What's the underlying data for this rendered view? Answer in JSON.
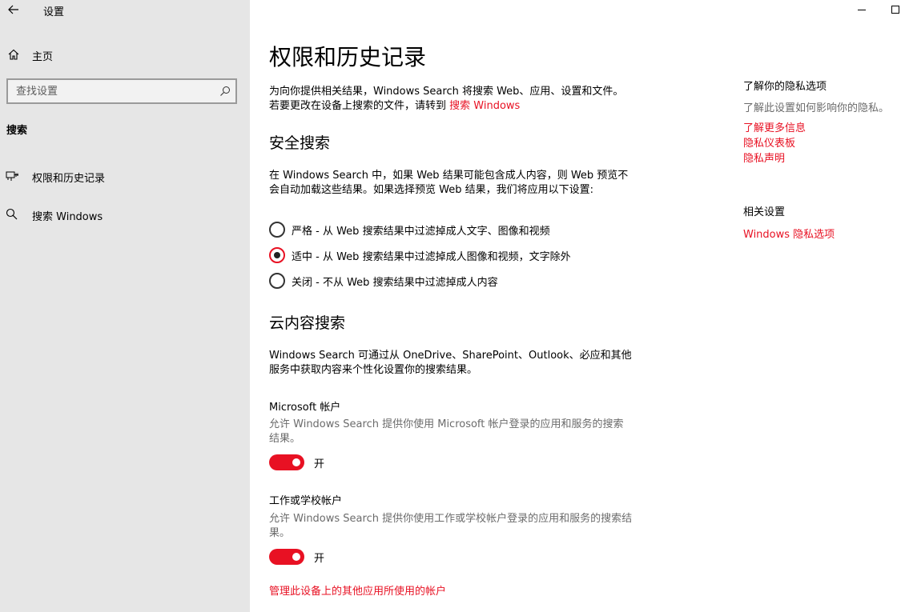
{
  "window": {
    "title": "设置",
    "back_icon": "arrow-left-icon",
    "minimize_icon": "minimize-icon",
    "maximize_icon": "maximize-icon"
  },
  "sidebar": {
    "home": {
      "label": "主页",
      "icon": "home-icon"
    },
    "search": {
      "placeholder": "查找设置",
      "icon": "search-icon"
    },
    "section_heading": "搜索",
    "items": [
      {
        "label": "权限和历史记录",
        "icon": "permissions-icon",
        "selected": true
      },
      {
        "label": "搜索 Windows",
        "icon": "search-icon",
        "selected": false
      }
    ]
  },
  "main": {
    "title": "权限和历史记录",
    "intro_text": "为向你提供相关结果，Windows Search 将搜索 Web、应用、设置和文件。若要更改在设备上搜索的文件，请转到 ",
    "intro_link": "搜索 Windows",
    "safe_search": {
      "heading": "安全搜索",
      "description": "在 Windows Search 中，如果 Web 结果可能包含成人内容，则 Web 预览不会自动加载这些结果。如果选择预览 Web 结果，我们将应用以下设置:",
      "options": [
        {
          "label": "严格 - 从 Web 搜索结果中过滤掉成人文字、图像和视频",
          "checked": false
        },
        {
          "label": "适中 - 从 Web 搜索结果中过滤掉成人图像和视频，文字除外",
          "checked": true
        },
        {
          "label": "关闭 - 不从 Web 搜索结果中过滤掉成人内容",
          "checked": false
        }
      ]
    },
    "cloud_search": {
      "heading": "云内容搜索",
      "description": "Windows Search 可通过从 OneDrive、SharePoint、Outlook、必应和其他服务中获取内容来个性化设置你的搜索结果。",
      "microsoft_account": {
        "label": "Microsoft 帐户",
        "description": "允许 Windows Search 提供你使用 Microsoft 帐户登录的应用和服务的搜索结果。",
        "toggle_state": "开",
        "on": true
      },
      "work_account": {
        "label": "工作或学校帐户",
        "description": "允许 Windows Search 提供你使用工作或学校帐户登录的应用和服务的搜索结果。",
        "toggle_state": "开",
        "on": true
      },
      "manage_link": "管理此设备上的其他应用所使用的帐户"
    }
  },
  "right_panel": {
    "privacy_heading": "了解你的隐私选项",
    "privacy_desc": "了解此设置如何影响你的隐私。",
    "links": [
      "了解更多信息",
      "隐私仪表板",
      "隐私声明"
    ],
    "related_heading": "相关设置",
    "related_link": "Windows 隐私选项"
  },
  "colors": {
    "accent": "#e81123",
    "sidebar_bg": "#e6e6e6",
    "secondary_text": "#6b6b6b"
  }
}
